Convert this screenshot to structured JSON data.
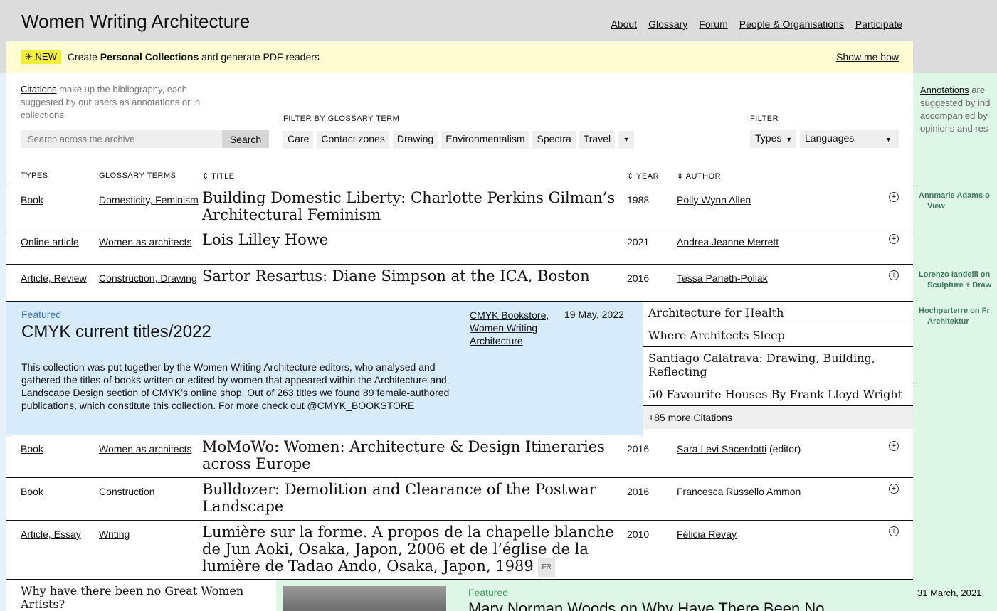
{
  "site": {
    "title": "Women Writing Architecture",
    "nav": [
      "About",
      "Glossary",
      "Forum",
      "People & Organisations",
      "Participate"
    ]
  },
  "banner": {
    "badge": "✳ NEW",
    "text_pre": "Create ",
    "text_bold": "Personal Collections",
    "text_post": " and generate PDF readers",
    "cta": "Show me how"
  },
  "intro": {
    "link": "Citations",
    "text": " make up the bibliography, each suggested by our users as annotations or in collections."
  },
  "search": {
    "placeholder": "Search across the archive",
    "button": "Search"
  },
  "glossary_filter": {
    "label_pre": "FILTER BY ",
    "label_link": "GLOSSARY",
    "label_post": " TERM",
    "chips": [
      "Care",
      "Contact zones",
      "Drawing",
      "Environmentalism",
      "Spectra",
      "Travel"
    ],
    "more": "▼"
  },
  "filter": {
    "label": "FILTER",
    "types": "Types",
    "languages": "Languages"
  },
  "table": {
    "headers": {
      "types": "TYPES",
      "terms": "GLOSSARY TERMS",
      "title": "⇕ TITLE",
      "year": "⇕ YEAR",
      "author": "⇕ AUTHOR"
    },
    "rows_top": [
      {
        "types": "Book",
        "terms": "Domesticity, Feminism",
        "title": "Building Domestic Liberty: Charlotte Perkins Gilman’s Architectural Feminism",
        "year": "1988",
        "author": "Polly Wynn Allen"
      },
      {
        "types": "Online article",
        "terms": "Women as architects",
        "title": "Lois Lilley Howe",
        "year": "2021",
        "author": "Andrea Jeanne Merrett"
      },
      {
        "types": "Article, Review",
        "terms": "Construction, Drawing",
        "title": "Sartor Resartus: Diane Simpson at the ICA, Boston",
        "year": "2016",
        "author": "Tessa Paneth-Pollak"
      }
    ],
    "rows_bottom": [
      {
        "types": "Book",
        "terms": "Women as architects",
        "title": "MoMoWo: Women: Architecture & Design Itineraries across Europe",
        "year": "2016",
        "author": "Sara Levi Sacerdotti",
        "author_suffix": " (editor)"
      },
      {
        "types": "Book",
        "terms": "Construction",
        "title": "Bulldozer: Demolition and Clearance of the Postwar Landscape",
        "year": "2016",
        "author": "Francesca Russello Ammon"
      },
      {
        "types": "Article, Essay",
        "terms": "Writing",
        "title": "Lumière sur la forme. A propos de la chapelle blanche de Jun Aoki, Osaka, Japon, 2006 et de l’église de la lumière de Tadao Ando, Osaka, Japon, 1989",
        "lang": "FR",
        "year": "2010",
        "author": "Félicia Revay"
      }
    ]
  },
  "featured": {
    "tag": "Featured",
    "title": "CMYK current titles/2022",
    "by": "CMYK Bookstore, Women Writing Architecture",
    "date": "19 May, 2022",
    "description": "This collection was put together by the Women Writing Architecture editors, who analysed and gathered the titles of books written or edited by women that appeared within the Architecture and Landscape Design section of CMYK’s online shop. Out of 263 titles we found 89 female-authored publications, which constitute this collection. For more check out @CMYK_BOOKSTORE",
    "citations": [
      "Architecture for Health",
      "Where Architects Sleep",
      "Santiago Calatrava: Drawing, Building, Reflecting",
      "50 Favourite Houses By Frank Lloyd Wright"
    ],
    "more": "+85 more Citations"
  },
  "annotations": {
    "intro_link": "Annotations",
    "intro_lines": [
      " are",
      "suggested by ind",
      "accompanied by",
      "opinions and res"
    ],
    "items": [
      {
        "line1": "Annmarie Adams o",
        "line2": "View"
      },
      {
        "line1": "Lorenzo Iandelli on",
        "line2": "Sculpture + Draw"
      },
      {
        "line1": "Hochparterre on Fr",
        "line2": "Architektur"
      }
    ],
    "date": "31 March, 2021"
  },
  "bottom": {
    "left_title": "Why have there been no Great Women Artists?",
    "featured_tag": "Featured",
    "featured_title": "Mary Norman Woods on Why Have There Been No"
  }
}
